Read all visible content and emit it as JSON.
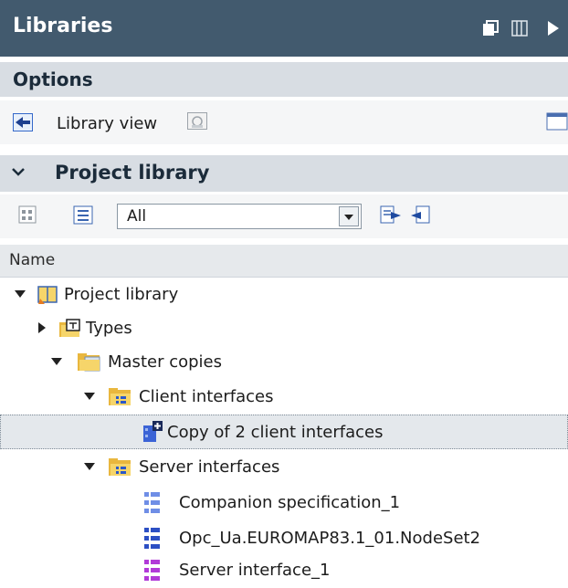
{
  "panel": {
    "title": "Libraries"
  },
  "options": {
    "label": "Options"
  },
  "library_view": {
    "label": "Library view"
  },
  "project_library_section": {
    "label": "Project library"
  },
  "toolbar": {
    "filter_value": "All"
  },
  "column_header": {
    "name": "Name"
  },
  "tree": [
    {
      "label": "Project library",
      "expanded": true
    },
    {
      "label": "Types",
      "expanded": false
    },
    {
      "label": "Master copies",
      "expanded": true
    },
    {
      "label": "Client interfaces",
      "expanded": true
    },
    {
      "label": "Copy of 2 client interfaces",
      "selected": true
    },
    {
      "label": "Server interfaces",
      "expanded": true
    },
    {
      "label": "Companion specification_1"
    },
    {
      "label": "Opc_Ua.EUROMAP83.1_01.NodeSet2"
    },
    {
      "label": "Server interface_1"
    }
  ],
  "colors": {
    "title_bar": "#425a6e",
    "section_bar": "#d8dde3",
    "selection": "#e4e8ec",
    "folder": "#f6d56a",
    "interface_blue": "#3b63d6",
    "interface_purple": "#b13ad8"
  }
}
